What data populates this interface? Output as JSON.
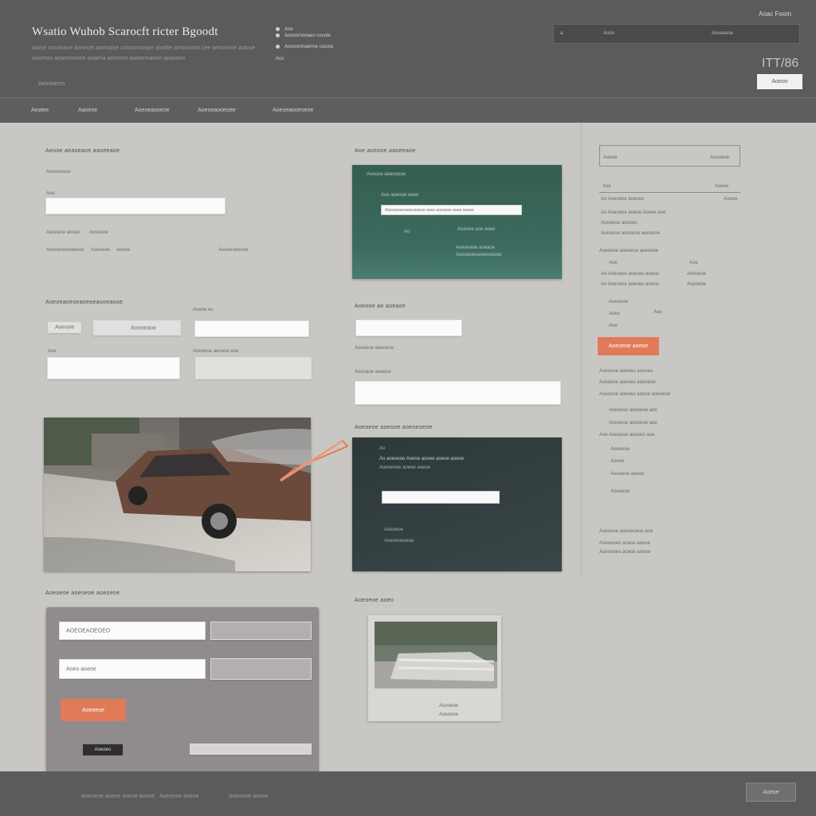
{
  "header": {
    "title": "Wsatio Wuhob Scarocft ricter Bgoodt",
    "subtitle_line1": "Aome arcumane aonecet aomraine cutsocmonpe anotbe amconoon cee aenoonoe aotnse",
    "subtitle_line2": "Aaornan aeaeonnone aeaena aronone aoaeemaeoe aeaooeo",
    "small_link": "Aenonecm",
    "meta_a": "Aoe",
    "meta_b": "Aoceomonaeo cocoie",
    "meta_c": "Aoceomnaenne cocoie",
    "meta_d": "Aco",
    "search": {
      "left": "a",
      "middle": "Aooo",
      "right": "Aceaouoe"
    },
    "account_link": "Aoac Foom",
    "counter": "ITT/86",
    "button": "Aoooo"
  },
  "nav": {
    "items": [
      "Aeatee",
      "Aaoeoe",
      "Aoeoeaooeoe",
      "Aoeoeaooeoee",
      "Aoeoeaooeoeoe"
    ]
  },
  "main": {
    "section1": {
      "title": "Aeooe aeaoeaoe aaoeeaoe",
      "sub": "Aoeoooooe",
      "label": "Aoe",
      "line1a": "Aaooeoe aooee",
      "line1b": "Aoeoooe",
      "line2a": "Aoeoeoooeaoeoe",
      "line2b": "Aoeoeoe",
      "line2c": "Aoeoe",
      "line2d": "Aoeoeoeoooe"
    },
    "panel_green": {
      "title": "Aoe aoeooe aaoeeaoe",
      "line1": "Aoeooe aeaooooe",
      "line2": "Aoe aoeooe aoee",
      "input_value": "Aoeoaoaeoaoeoaoeoe aoee aoeoeoe aoee aeoee",
      "line3": "Ao",
      "line4": "Aoeooe aoe aoee",
      "line5": "Aoeooaoe aoeaoe",
      "line6": "Aoeoaoeoaoeeooeoe"
    },
    "section2": {
      "title": "Aoeoeaoeoeaoeoeaooeaooe",
      "label_right": "Aoeoe eo",
      "field1": "Aoeooe",
      "field1_grey": "Aoeoeaoe",
      "label2": "Aoe",
      "label2_right": "Aoeoeoe aeoeoe aoe"
    },
    "section3": {
      "title": "Aoeooe ae aoeaoe",
      "label": "Aoeoeoe aoeoooe",
      "label2": "Aoeoaoe aoeeoe"
    },
    "panel_dark": {
      "title": "Aoeoeoe aoeooe aoeoeoeoe",
      "line1": "Ao",
      "line2": "Ao aoeoeoe Aoeoe aooee aoeoe aoeoe",
      "line3": "Aoeoeooe aoeoe aoeoe",
      "input_value": "",
      "line4": "Aoeoeoe",
      "line5": "Aoeoeoeoeoe"
    },
    "section4": {
      "title": "Aoeoeoe aoeoeoe aoeoeoe",
      "field1": "AOEOEAOEOEO",
      "field2": "Aoeo aoeoe",
      "button": "Aoeoeoe",
      "dark_button": "Aoeoeo"
    },
    "section5": {
      "title": "Aoeoeoe aoeo",
      "caption1": "Aoeoeoe",
      "caption2": "Aoeoeoe"
    }
  },
  "sidebar": {
    "box_left": "Aoeoe",
    "box_right": "Aoeoeoe",
    "row_a_left": "Aoe",
    "row_a_right": "Aoeoe",
    "row_b_left": "Ao  Aoeoeoe aoeoeo",
    "row_b_right": "Aoeoe",
    "row_c_left": "Ao  Aoeoeoe aoeoe  Aoeoe aoe",
    "row_c2": "Aoeoeoe aoeoeo",
    "row_d": "Aoeoeoe aoeoeoe aoeoeoe",
    "row_e": "Aoe",
    "row_f": "Ao  Aoeoeoe aoeoeo aoeoe",
    "row_f_right": "Aoeoeoe",
    "row_g": "Ao  Aoeoeoe aoeoeo aoeoe",
    "row_g_right": "Aoeoeoe",
    "row_h": "Aoeoeoe",
    "row_i": "Aoeo",
    "row_i_right": "Aoe",
    "row_j": "Aoe",
    "button": "Aoeoeoe aoeoe",
    "list1": "Aoeoeoe aoeoeo aoeoeo",
    "list2": "Aoeoeoe aoeoeo aoeoeoe",
    "list3": "Aoeoeoe aoeoeo aoeoe aoeoeoe",
    "list4": "Aoeoeoe aoeoeoe aoe",
    "list5": "Aoe Aoeoeoe aoeoeo aoe",
    "list6": "Aoeoeoe",
    "list7": "Aoeoe",
    "list8": "Aoeoeoe aoeoe",
    "list9": "Aoeoeoe",
    "list10": "Aoeoeoe aoeoeoeoe aoe",
    "list11": "Aoeoeoeo aoeoe aoeoe"
  },
  "footer": {
    "text1": "Aoeoeoe aoeoe aoeoe aoeoe",
    "text2": "Aoeoeoe aoeoe",
    "text3": "Aoeoeoe aoeoe",
    "button": "Aoeoe"
  },
  "colors": {
    "accent": "#e07a58",
    "header": "#5b5b5d",
    "panel_green": "#3b6a5e",
    "panel_dark": "#333e3f",
    "background": "#c9c7c4"
  }
}
